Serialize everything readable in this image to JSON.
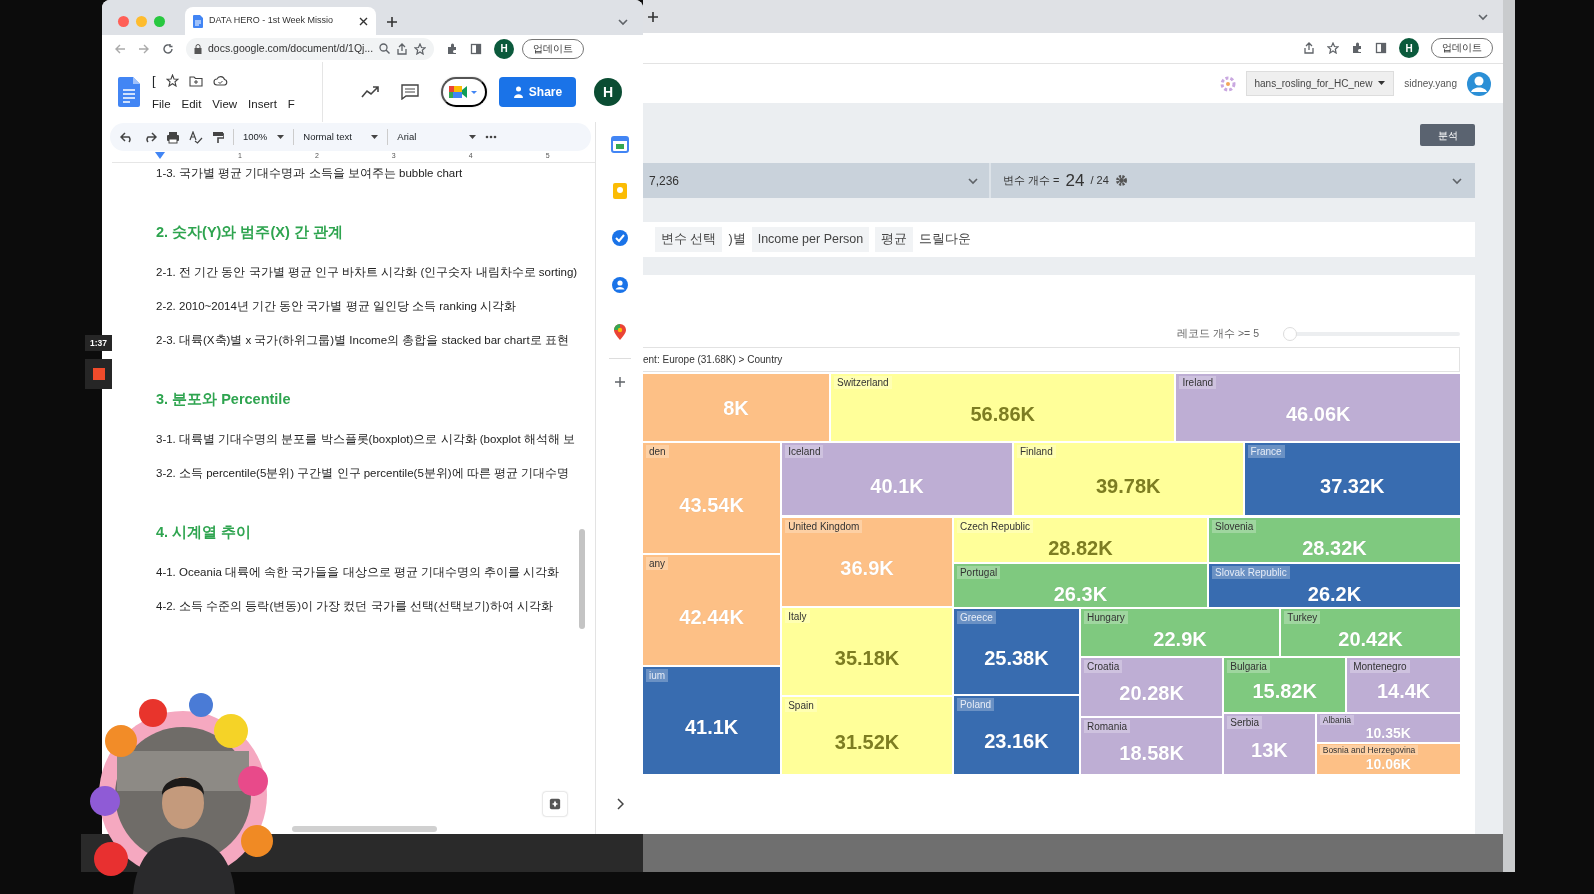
{
  "recorder": {
    "time": "1:37"
  },
  "docs_window": {
    "tab_title": "DATA HERO - 1st Week Missio",
    "url": "docs.google.com/document/d/1Qj...",
    "update_button": "업데이트",
    "profile": "H",
    "doc_title": "[",
    "menu": [
      "File",
      "Edit",
      "View",
      "Insert",
      "F"
    ],
    "share_button": "Share",
    "account": "H",
    "toolbar": {
      "zoom": "100%",
      "style": "Normal text",
      "font": "Arial"
    },
    "ruler": [
      "1",
      "2",
      "3",
      "4",
      "5"
    ],
    "body": [
      {
        "kind": "item",
        "text": "1-3. 국가별 평균 기대수명과 소득을 보여주는 bubble chart"
      },
      {
        "kind": "heading",
        "text": "2. 숫자(Y)와 범주(X) 간 관계"
      },
      {
        "kind": "item",
        "text": "2-1. 전 기간 동안 국가별 평균 인구 바차트 시각화 (인구숫자 내림차수로 sorting)"
      },
      {
        "kind": "item",
        "text": "2-2. 2010~2014년 기간 동안 국가별 평균 일인당 소득 ranking 시각화"
      },
      {
        "kind": "item",
        "text": "2-3. 대륙(X축)별 x 국가(하위그룹)별 Income의 총합을 stacked bar chart로 표현"
      },
      {
        "kind": "heading",
        "text": "3. 분포와 Percentile"
      },
      {
        "kind": "item",
        "text": "3-1. 대륙별 기대수명의 분포를 박스플롯(boxplot)으로 시각화 (boxplot 해석해 보"
      },
      {
        "kind": "item",
        "text": "3-2. 소득 percentile(5분위) 구간별 인구 percentile(5분위)에 따른 평균 기대수명"
      },
      {
        "kind": "heading",
        "text": "4. 시계열 추이"
      },
      {
        "kind": "item",
        "text": "4-1. Oceania 대륙에 속한 국가들을 대상으로 평균 기대수명의 추이를 시각화"
      },
      {
        "kind": "item",
        "text": "4-2. 소득 수준의 등락(변동)이 가장 컸던 국가를 선택(선택보기)하여 시각화"
      }
    ]
  },
  "app_window": {
    "update_button": "업데이트",
    "profile": "H",
    "project": "hans_rosling_for_HC_new",
    "user": "sidney.yang",
    "analyze_button": "분석",
    "record_count": "7,236",
    "variables": {
      "label": "변수 개수 =",
      "count": "24",
      "total": "/ 24"
    },
    "query": [
      {
        "kind": "chip",
        "text": "변수 선택"
      },
      {
        "kind": "plain",
        "text": ")별"
      },
      {
        "kind": "chip",
        "text": "Income per Person"
      },
      {
        "kind": "chip",
        "text": "평균"
      },
      {
        "kind": "plain",
        "text": "드릴다운"
      }
    ],
    "record_filter": {
      "label": "레코드 개수 >=",
      "value": "5",
      "level": 0
    },
    "breadcrumb": "ent: Europe (31.68K) > Country",
    "treemap": [
      {
        "value": "8K",
        "color": "#fdc086"
      },
      {
        "name": "Switzerland",
        "value": "56.86K",
        "color": "#ffff99"
      },
      {
        "name": "Ireland",
        "value": "46.06K",
        "color": "#beaed4"
      },
      {
        "name": "den",
        "value": "43.54K",
        "color": "#fdc086"
      },
      {
        "name": "Iceland",
        "value": "40.1K",
        "color": "#beaed4"
      },
      {
        "name": "Finland",
        "value": "39.78K",
        "color": "#ffff99"
      },
      {
        "name": "France",
        "value": "37.32K",
        "color": "#386cb0"
      },
      {
        "name": "United Kingdom",
        "value": "36.9K",
        "color": "#fdc086"
      },
      {
        "name": "Czech Republic",
        "value": "28.82K",
        "color": "#ffff99"
      },
      {
        "name": "Slovenia",
        "value": "28.32K",
        "color": "#7fc97f"
      },
      {
        "name": "any",
        "value": "42.44K",
        "color": "#fdc086"
      },
      {
        "name": "Portugal",
        "value": "26.3K",
        "color": "#7fc97f"
      },
      {
        "name": "Slovak Republic",
        "value": "26.2K",
        "color": "#386cb0"
      },
      {
        "name": "Italy",
        "value": "35.18K",
        "color": "#ffff99"
      },
      {
        "name": "Greece",
        "value": "25.38K",
        "color": "#386cb0"
      },
      {
        "name": "Hungary",
        "value": "22.9K",
        "color": "#7fc97f"
      },
      {
        "name": "Turkey",
        "value": "20.42K",
        "color": "#7fc97f"
      },
      {
        "name": "Croatia",
        "value": "20.28K",
        "color": "#beaed4"
      },
      {
        "name": "Bulgaria",
        "value": "15.82K",
        "color": "#7fc97f"
      },
      {
        "name": "Montenegro",
        "value": "14.4K",
        "color": "#beaed4"
      },
      {
        "name": "ium",
        "value": "41.1K",
        "color": "#386cb0"
      },
      {
        "name": "Spain",
        "value": "31.52K",
        "color": "#ffff99"
      },
      {
        "name": "Poland",
        "value": "23.16K",
        "color": "#386cb0"
      },
      {
        "name": "Romania",
        "value": "18.58K",
        "color": "#beaed4"
      },
      {
        "name": "Serbia",
        "value": "13K",
        "color": "#beaed4"
      },
      {
        "name": "Albania",
        "value": "10.35K",
        "color": "#beaed4"
      },
      {
        "name": "Bosnia and Herzegovina",
        "value": "10.06K",
        "color": "#fdc086"
      }
    ]
  }
}
